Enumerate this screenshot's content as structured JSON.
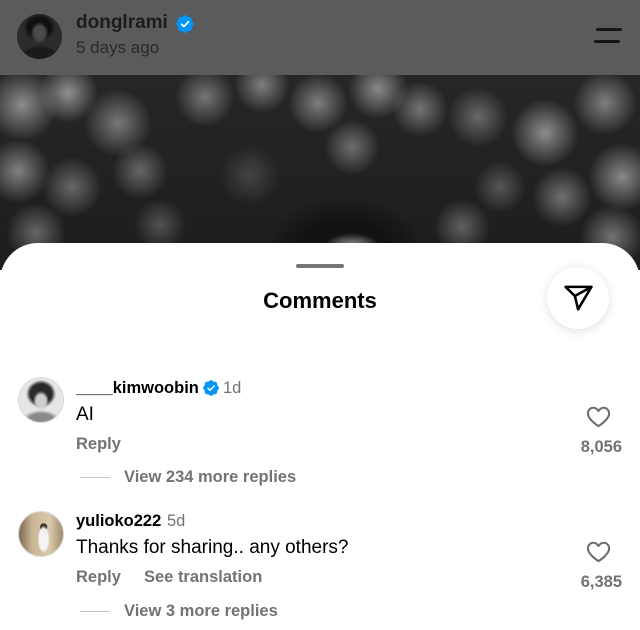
{
  "header": {
    "username": "donglrami",
    "timestamp": "5 days ago",
    "verified": true
  },
  "comments_sheet": {
    "title": "Comments"
  },
  "comments": [
    {
      "username": "____kimwoobin",
      "verified": true,
      "age": "1d",
      "text": "AI",
      "reply_label": "Reply",
      "likes": "8,056",
      "view_replies_label": "View 234 more replies"
    },
    {
      "username": "yulioko222",
      "verified": false,
      "age": "5d",
      "text": "Thanks for sharing.. any others?",
      "reply_label": "Reply",
      "translate_label": "See translation",
      "likes": "6,385",
      "view_replies_label": "View 3 more replies"
    }
  ],
  "icons": {
    "header_menu": "menu-icon",
    "share": "send-icon",
    "like": "heart-icon",
    "verified": "verified-badge-icon"
  },
  "colors": {
    "overlay": "#5b5b5b",
    "verified_blue": "#0095f6",
    "secondary_text": "#737373",
    "sheet_background": "#ffffff"
  }
}
